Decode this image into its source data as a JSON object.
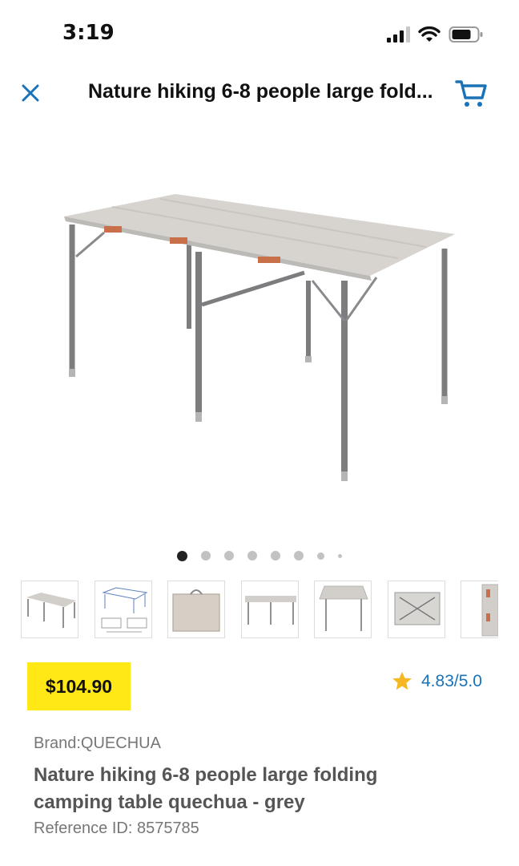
{
  "status_bar": {
    "time": "3:19"
  },
  "nav": {
    "title": "Nature hiking 6-8 people large fold..."
  },
  "gallery": {
    "image_count": 8,
    "active_index": 0,
    "thumbnails": [
      "table-side-view",
      "dimensions-diagram",
      "folded-case",
      "table-front-view",
      "table-top-view",
      "table-underside",
      "folded-side"
    ]
  },
  "product": {
    "price": "$104.90",
    "rating": "4.83/5.0",
    "brand": "Brand:QUECHUA",
    "name_line1": "Nature hiking 6-8 people large folding",
    "name_line2": "camping table quechua - grey",
    "reference": "Reference ID: 8575785"
  },
  "colors": {
    "accent": "#1a73b8",
    "price_bg": "#ffe816",
    "star": "#f5b823"
  }
}
